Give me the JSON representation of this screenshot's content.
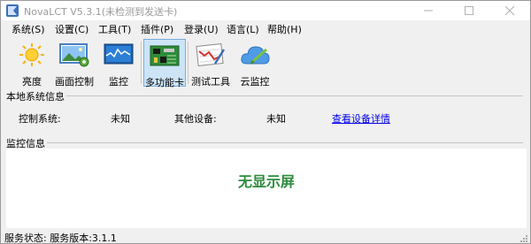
{
  "window": {
    "title": "NovaLCT V5.3.1(未检测到发送卡)"
  },
  "menu": {
    "items": [
      "系统(S)",
      "设置(C)",
      "工具(T)",
      "插件(P)",
      "登录(U)",
      "语言(L)",
      "帮助(H)"
    ]
  },
  "toolbar": {
    "tools": [
      {
        "label": "亮度",
        "icon": "sun-icon",
        "selected": false
      },
      {
        "label": "画面控制",
        "icon": "picture-control-icon",
        "selected": false
      },
      {
        "label": "监控",
        "icon": "monitor-icon",
        "selected": false
      },
      {
        "label": "多功能卡",
        "icon": "multifunction-card-icon",
        "selected": true
      },
      {
        "label": "测试工具",
        "icon": "test-tools-icon",
        "selected": false
      },
      {
        "label": "云监控",
        "icon": "cloud-monitor-icon",
        "selected": false
      }
    ]
  },
  "local_info": {
    "title": "本地系统信息",
    "control_system_label": "控制系统:",
    "control_system_value": "未知",
    "other_devices_label": "其他设备:",
    "other_devices_value": "未知",
    "details_link": "查看设备详情"
  },
  "monitor_info": {
    "title": "监控信息",
    "message": "无显示屏"
  },
  "status": {
    "text": "服务状态: 服务版本:3.1.1"
  },
  "colors": {
    "accent_green": "#2c8b3c",
    "link_blue": "#0000ee",
    "selected_bg": "#cde4f7"
  }
}
